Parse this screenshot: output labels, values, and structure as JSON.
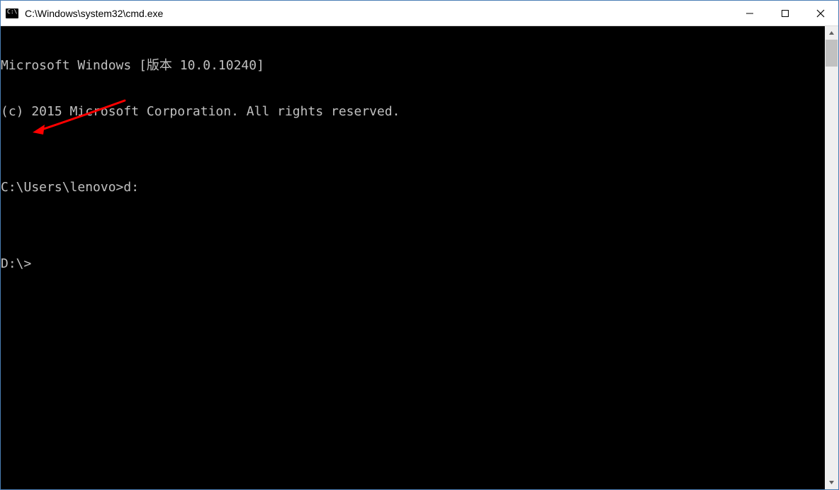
{
  "titlebar": {
    "title": "C:\\Windows\\system32\\cmd.exe"
  },
  "console": {
    "lines": [
      "Microsoft Windows [版本 10.0.10240]",
      "(c) 2015 Microsoft Corporation. All rights reserved.",
      "",
      "C:\\Users\\lenovo>d:",
      "",
      "D:\\>"
    ]
  }
}
